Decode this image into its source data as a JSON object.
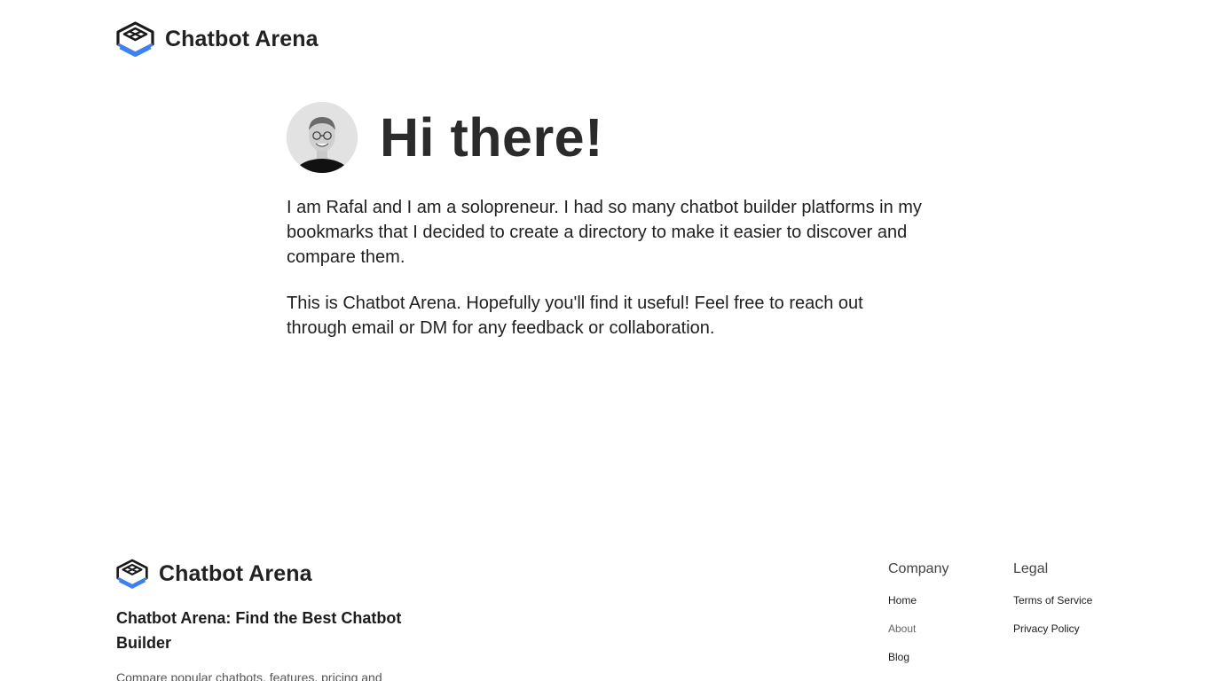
{
  "header": {
    "brand_name": "Chatbot Arena",
    "logo_icon": "ring-cube-logo-icon"
  },
  "hero": {
    "title": "Hi there!",
    "avatar_icon": "avatar",
    "paragraphs": [
      "I am Rafal and I am a solopreneur. I had so many chatbot builder platforms in my bookmarks that I decided to create a directory to make it easier to discover and compare them.",
      "This is Chatbot Arena. Hopefully you'll find it useful! Feel free to reach out through email or DM for any feedback or collaboration."
    ]
  },
  "footer": {
    "brand_name": "Chatbot Arena",
    "tagline": "Chatbot Arena: Find the Best Chatbot Builder",
    "description": "Compare popular chatbots, features, pricing and",
    "columns": {
      "company": {
        "heading": "Company",
        "links": [
          "Home",
          "About",
          "Blog"
        ]
      },
      "legal": {
        "heading": "Legal",
        "links": [
          "Terms of Service",
          "Privacy Policy"
        ]
      }
    }
  },
  "colors": {
    "accent_blue": "#3b82f6",
    "text_dark": "#222222",
    "background": "#ffffff"
  }
}
